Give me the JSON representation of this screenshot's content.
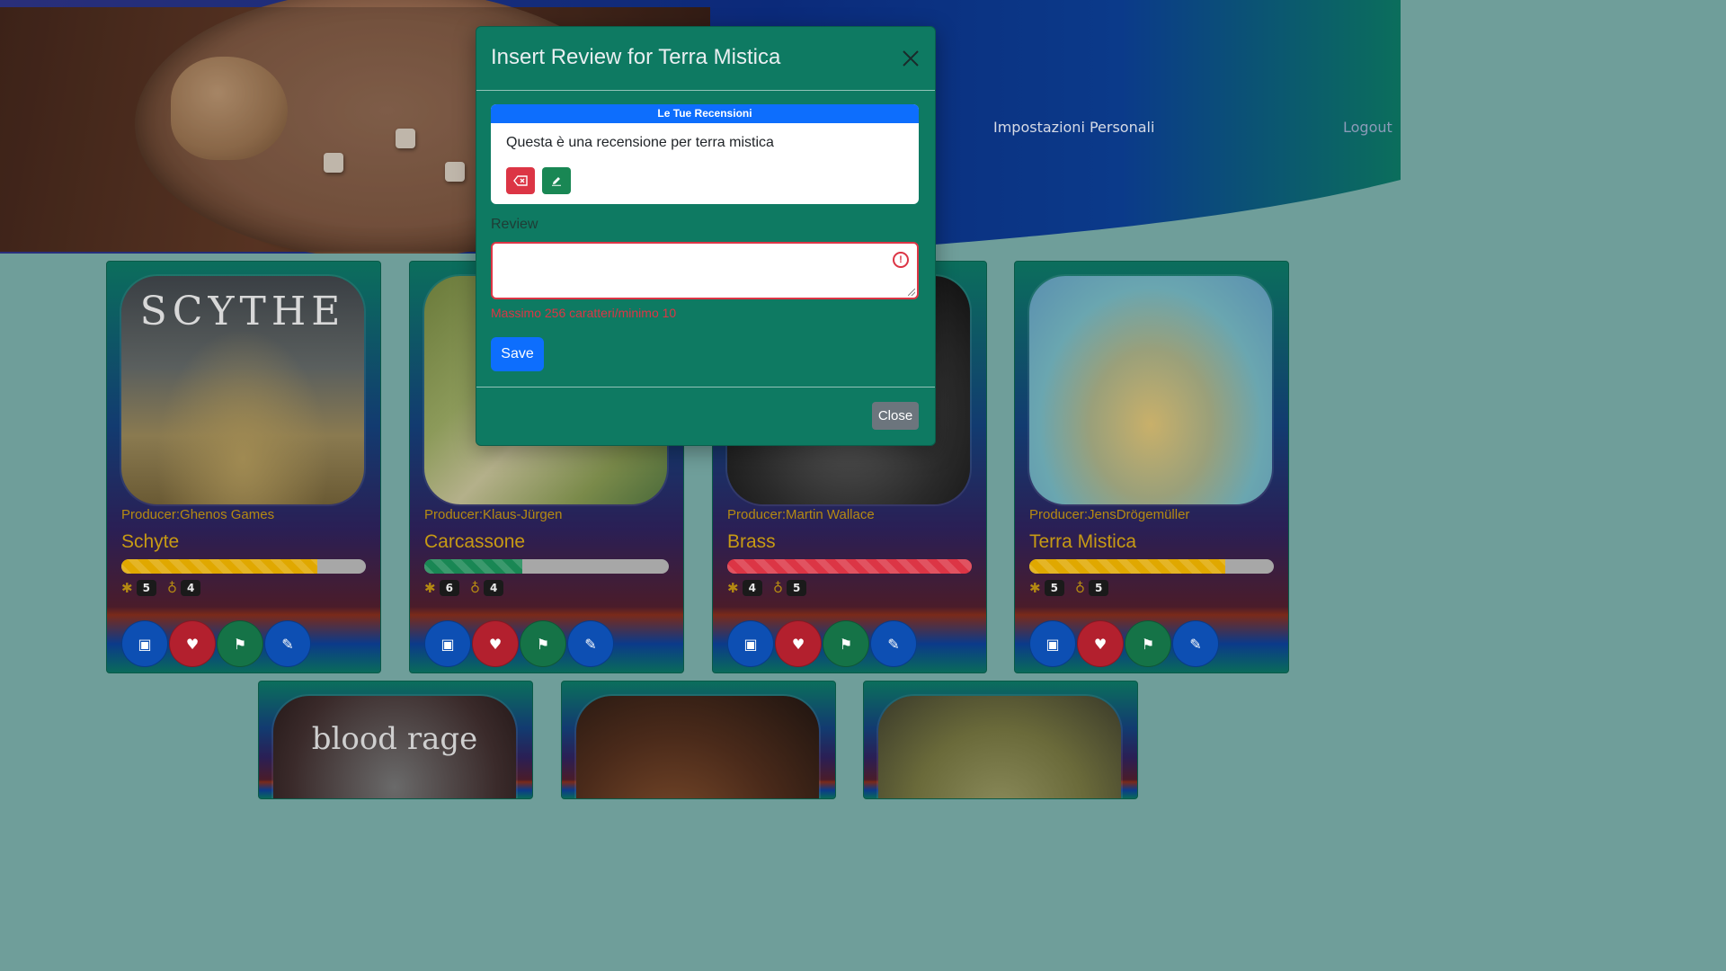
{
  "nav": {
    "settings_label": "Impostazioni Personali",
    "logout_label": "Logout"
  },
  "cards": [
    {
      "producer": "Producer:Ghenos Games",
      "title": "Schyte",
      "rating": 0.8,
      "bar_color": "#e0a800",
      "stat1": "5",
      "stat2": "4"
    },
    {
      "producer": "Producer:Klaus-Jürgen",
      "title": "Carcassone",
      "rating": 0.4,
      "bar_color": "#198754",
      "stat1": "6",
      "stat2": "4"
    },
    {
      "producer": "Producer:Martin Wallace",
      "title": "Brass",
      "rating": 1.0,
      "bar_color": "#dc3545",
      "stat1": "4",
      "stat2": "5"
    },
    {
      "producer": "Producer:JensDrögemüller",
      "title": "Terra Mistica",
      "rating": 0.8,
      "bar_color": "#e0a800",
      "stat1": "5",
      "stat2": "5"
    }
  ],
  "card_actions": [
    "box-icon",
    "heart-plus-icon",
    "flag-icon",
    "edit-icon"
  ],
  "card_images": [
    "Scythe cover",
    "Carcassonne board",
    "Brass cover",
    "Terra Mystica board",
    "Blood Rage cover",
    "game cover",
    "map board"
  ],
  "modal": {
    "title": "Insert Review for Terra Mistica",
    "reviews_header": "Le Tue Recensioni",
    "existing_review": "Questa è una recensione per terra mistica",
    "field_label": "Review",
    "textarea_value": "",
    "validation_message": "Massimo 256 caratteri/minimo 10",
    "save_label": "Save",
    "close_label": "Close"
  },
  "colors": {
    "primary": "#0d6efd",
    "danger": "#dc3545",
    "success": "#198754",
    "secondary": "#6c757d",
    "modal_bg": "#0e7a62",
    "gold": "#c79a14"
  }
}
